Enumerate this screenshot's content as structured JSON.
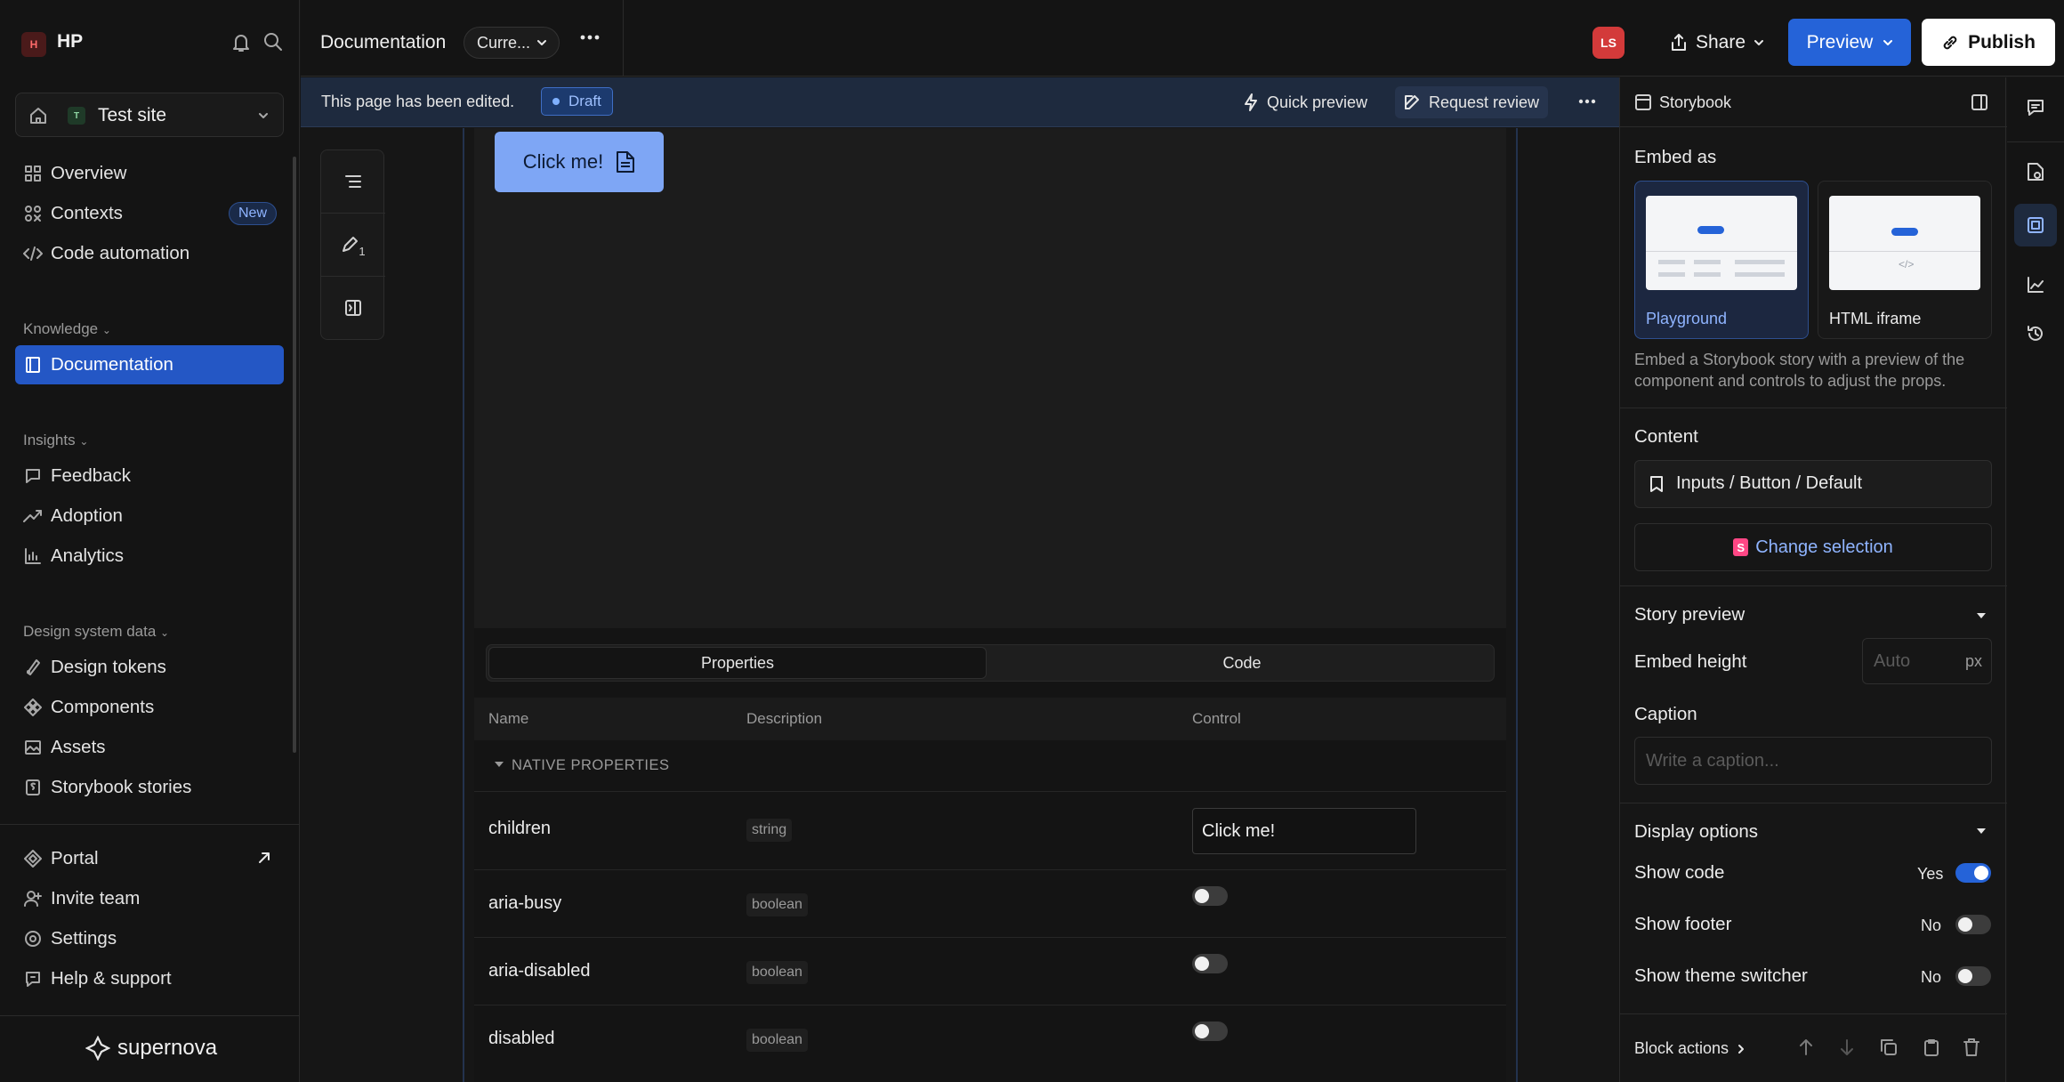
{
  "workspace": {
    "badge": "H",
    "name": "HP"
  },
  "site": {
    "badge": "T",
    "name": "Test site"
  },
  "nav_top": [
    {
      "label": "Overview",
      "icon": "grid-icon"
    },
    {
      "label": "Contexts",
      "icon": "contexts-icon",
      "badge": "New"
    },
    {
      "label": "Code automation",
      "icon": "code-icon"
    }
  ],
  "sections": {
    "knowledge": "Knowledge",
    "insights": "Insights",
    "design_system_data": "Design system data"
  },
  "nav_knowledge": [
    {
      "label": "Documentation",
      "icon": "book-icon",
      "active": true
    }
  ],
  "nav_insights": [
    {
      "label": "Feedback",
      "icon": "feedback-icon"
    },
    {
      "label": "Adoption",
      "icon": "trend-icon"
    },
    {
      "label": "Analytics",
      "icon": "chart-icon"
    }
  ],
  "nav_dsd": [
    {
      "label": "Design tokens",
      "icon": "tokens-icon"
    },
    {
      "label": "Components",
      "icon": "components-icon"
    },
    {
      "label": "Assets",
      "icon": "assets-icon"
    },
    {
      "label": "Storybook stories",
      "icon": "storybook-icon"
    }
  ],
  "nav_bottom": [
    {
      "label": "Portal",
      "icon": "portal-icon"
    },
    {
      "label": "Invite team",
      "icon": "user-plus-icon"
    },
    {
      "label": "Settings",
      "icon": "gear-icon"
    },
    {
      "label": "Help & support",
      "icon": "help-icon"
    }
  ],
  "footer_brand": "supernova",
  "topbar": {
    "title": "Documentation",
    "branch": "Curre...",
    "avatar": "LS",
    "share": "Share",
    "preview": "Preview",
    "publish": "Publish"
  },
  "banner": {
    "text": "This page has been edited.",
    "status": "Draft",
    "quick_preview": "Quick preview",
    "request_review": "Request review"
  },
  "canvas": {
    "edit_count": "1",
    "story_button": "Click me!",
    "tabs": [
      "Properties",
      "Code"
    ],
    "columns": [
      "Name",
      "Description",
      "Control"
    ],
    "group": "NATIVE PROPERTIES",
    "rows": [
      {
        "name": "children",
        "type": "string",
        "control": "Click me!"
      },
      {
        "name": "aria-busy",
        "type": "boolean"
      },
      {
        "name": "aria-disabled",
        "type": "boolean"
      },
      {
        "name": "disabled",
        "type": "boolean"
      }
    ]
  },
  "panel": {
    "title": "Storybook",
    "embed_as": "Embed as",
    "options": [
      {
        "label": "Playground",
        "selected": true
      },
      {
        "label": "HTML iframe",
        "selected": false
      }
    ],
    "description": "Embed a Storybook story with a preview of the component and controls to adjust the props.",
    "content": "Content",
    "story_path": "Inputs / Button / Default",
    "change_selection": "Change selection",
    "story_preview": "Story preview",
    "embed_height": "Embed height",
    "height_placeholder": "Auto",
    "height_unit": "px",
    "caption": "Caption",
    "caption_placeholder": "Write a caption...",
    "display_options": "Display options",
    "show_code": {
      "label": "Show code",
      "value": "Yes"
    },
    "show_footer": {
      "label": "Show footer",
      "value": "No"
    },
    "show_theme": {
      "label": "Show theme switcher",
      "value": "No"
    },
    "block_actions": "Block actions"
  },
  "colors": {
    "accent": "#2563d8",
    "active_nav": "#2457c5",
    "story_button": "#7ea6f5"
  }
}
